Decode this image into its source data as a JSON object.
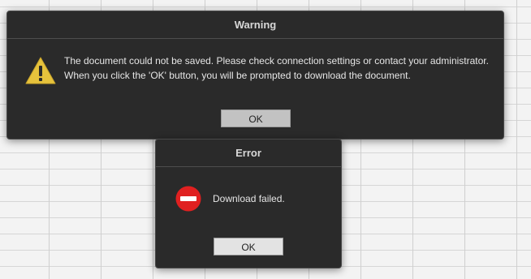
{
  "warning_dialog": {
    "title": "Warning",
    "icon": "warning-triangle-icon",
    "message_line1": "The document could not be saved. Please check connection settings or contact your administrator.",
    "message_line2": "When you click the 'OK' button, you will be prompted to download the document.",
    "ok_label": "OK"
  },
  "error_dialog": {
    "title": "Error",
    "icon": "error-stop-icon",
    "message": "Download failed.",
    "ok_label": "OK"
  },
  "colors": {
    "dialog_bg": "#2a2a2a",
    "warning_icon": "#e6c23c",
    "error_icon": "#e02020"
  }
}
